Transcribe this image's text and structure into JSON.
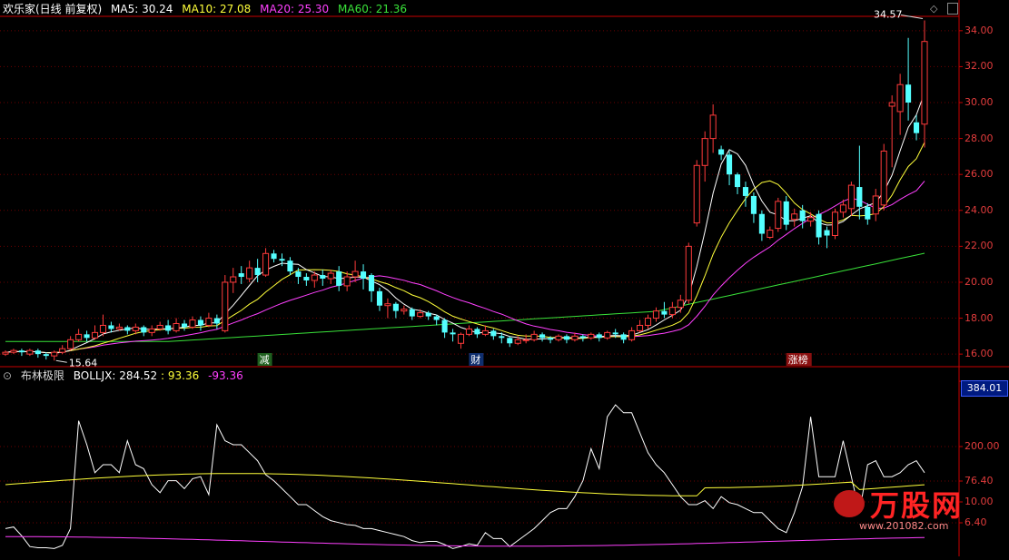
{
  "header": {
    "title": "欢乐家(日线 前复权)",
    "ma": [
      {
        "label": "MA5: 30.24",
        "color": "#ffffff"
      },
      {
        "label": "MA10: 27.08",
        "color": "#ffff3a"
      },
      {
        "label": "MA20: 25.30",
        "color": "#ff40ff"
      },
      {
        "label": "MA60: 21.36",
        "color": "#39e239"
      }
    ]
  },
  "indicator": {
    "label": "布林极限",
    "formula": "BOLLJX: 284.52",
    "upper": ": 93.36",
    "lower": "-93.36",
    "current_badge": "384.01",
    "y_ticks": [
      "384.01",
      "200.00",
      "76.40",
      "10.00",
      "6.40"
    ]
  },
  "markers": {
    "high_label": "34.57",
    "low_label": "15.64",
    "event_tags": [
      {
        "text": "减",
        "x_index": 32
      },
      {
        "text": "财",
        "x_index": 58
      },
      {
        "text": "涨榜",
        "x_index": 97
      }
    ]
  },
  "watermark": {
    "brand": "万股网",
    "site": "www.201082.com"
  },
  "colors": {
    "up": "#ff3b3b",
    "down": "#54ffff",
    "ma5": "#ffffff",
    "ma10": "#ffff3a",
    "ma20": "#ff40ff",
    "ma60": "#39e239",
    "grid": "#6b0000",
    "axis": "#c80000"
  },
  "chart_data": {
    "type": "candlestick",
    "price_axis": {
      "ylim": [
        15.3,
        34.8
      ],
      "ticks": [
        16.0,
        18.0,
        20.0,
        22.0,
        24.0,
        26.0,
        28.0,
        30.0,
        32.0,
        34.0
      ]
    },
    "candles": [
      [
        16.0,
        16.1,
        15.9,
        16.2
      ],
      [
        16.1,
        16.2,
        16.0,
        16.3
      ],
      [
        16.2,
        16.1,
        15.9,
        16.3
      ],
      [
        16.0,
        16.2,
        15.9,
        16.3
      ],
      [
        16.2,
        16.0,
        15.8,
        16.3
      ],
      [
        16.0,
        15.9,
        15.7,
        16.1
      ],
      [
        15.9,
        16.1,
        15.64,
        16.2
      ],
      [
        16.1,
        16.3,
        16.0,
        16.5
      ],
      [
        16.3,
        16.8,
        16.2,
        17.0
      ],
      [
        16.8,
        17.1,
        16.7,
        17.4
      ],
      [
        17.1,
        16.9,
        16.7,
        17.3
      ],
      [
        16.9,
        17.2,
        16.8,
        17.6
      ],
      [
        17.2,
        17.6,
        17.0,
        18.2
      ],
      [
        17.6,
        17.4,
        17.2,
        17.8
      ],
      [
        17.4,
        17.5,
        17.3,
        17.7
      ],
      [
        17.5,
        17.3,
        17.1,
        17.6
      ],
      [
        17.3,
        17.5,
        17.1,
        17.7
      ],
      [
        17.5,
        17.2,
        17.0,
        17.6
      ],
      [
        17.2,
        17.4,
        17.0,
        17.6
      ],
      [
        17.4,
        17.6,
        17.3,
        17.8
      ],
      [
        17.6,
        17.3,
        17.1,
        17.9
      ],
      [
        17.3,
        17.7,
        17.2,
        18.0
      ],
      [
        17.7,
        17.5,
        17.3,
        17.9
      ],
      [
        17.5,
        17.9,
        17.4,
        18.1
      ],
      [
        17.9,
        17.6,
        17.3,
        18.1
      ],
      [
        17.6,
        18.0,
        17.5,
        18.3
      ],
      [
        18.0,
        17.7,
        17.4,
        18.2
      ],
      [
        17.3,
        20.0,
        17.2,
        20.4
      ],
      [
        20.0,
        20.3,
        19.4,
        20.8
      ],
      [
        20.5,
        20.3,
        19.9,
        20.9
      ],
      [
        20.2,
        20.8,
        20.0,
        21.2
      ],
      [
        20.8,
        20.4,
        20.0,
        21.3
      ],
      [
        20.4,
        21.6,
        20.3,
        21.9
      ],
      [
        21.6,
        21.3,
        21.1,
        21.8
      ],
      [
        21.3,
        21.2,
        20.9,
        21.6
      ],
      [
        21.2,
        20.6,
        20.4,
        21.4
      ],
      [
        20.6,
        20.3,
        19.9,
        20.8
      ],
      [
        20.3,
        20.1,
        19.8,
        20.5
      ],
      [
        20.1,
        20.4,
        19.7,
        20.6
      ],
      [
        20.4,
        20.2,
        19.8,
        20.7
      ],
      [
        20.2,
        20.5,
        19.9,
        20.7
      ],
      [
        20.6,
        19.8,
        19.5,
        20.9
      ],
      [
        19.8,
        20.3,
        19.5,
        20.6
      ],
      [
        20.3,
        20.6,
        20.0,
        21.2
      ],
      [
        20.6,
        20.2,
        19.6,
        21.0
      ],
      [
        20.4,
        19.5,
        18.9,
        20.5
      ],
      [
        19.5,
        18.7,
        18.4,
        19.7
      ],
      [
        18.7,
        18.8,
        18.0,
        19.1
      ],
      [
        18.8,
        18.4,
        18.0,
        18.9
      ],
      [
        18.4,
        18.5,
        18.2,
        18.7
      ],
      [
        18.5,
        18.1,
        17.9,
        18.6
      ],
      [
        18.1,
        18.3,
        18.0,
        18.5
      ],
      [
        18.3,
        18.1,
        17.9,
        18.4
      ],
      [
        18.1,
        17.9,
        17.6,
        18.2
      ],
      [
        17.9,
        17.2,
        16.9,
        18.0
      ],
      [
        17.2,
        17.1,
        16.7,
        17.4
      ],
      [
        16.6,
        17.1,
        16.3,
        17.2
      ],
      [
        17.1,
        17.4,
        17.0,
        17.6
      ],
      [
        17.4,
        17.1,
        16.9,
        17.5
      ],
      [
        17.1,
        17.3,
        17.0,
        17.6
      ],
      [
        17.3,
        17.0,
        16.8,
        17.4
      ],
      [
        17.0,
        16.9,
        16.6,
        17.2
      ],
      [
        16.9,
        16.6,
        16.4,
        17.0
      ],
      [
        16.6,
        16.8,
        16.5,
        17.0
      ],
      [
        16.8,
        16.8,
        16.6,
        17.1
      ],
      [
        16.8,
        17.1,
        16.7,
        17.3
      ],
      [
        17.1,
        16.9,
        16.7,
        17.2
      ],
      [
        16.9,
        16.8,
        16.6,
        17.0
      ],
      [
        16.8,
        17.0,
        16.7,
        17.1
      ],
      [
        17.0,
        16.8,
        16.6,
        17.1
      ],
      [
        16.8,
        17.0,
        16.7,
        17.2
      ],
      [
        17.0,
        16.9,
        16.7,
        17.1
      ],
      [
        16.9,
        17.1,
        16.8,
        17.2
      ],
      [
        17.1,
        16.9,
        16.7,
        17.2
      ],
      [
        16.9,
        17.2,
        16.8,
        17.3
      ],
      [
        17.2,
        17.1,
        16.9,
        17.4
      ],
      [
        17.1,
        16.8,
        16.6,
        17.2
      ],
      [
        16.8,
        17.3,
        16.7,
        17.5
      ],
      [
        17.3,
        17.6,
        17.2,
        17.9
      ],
      [
        17.6,
        18.0,
        17.4,
        18.2
      ],
      [
        18.0,
        18.4,
        17.8,
        18.6
      ],
      [
        18.4,
        18.2,
        18.0,
        18.9
      ],
      [
        18.2,
        18.6,
        18.0,
        18.9
      ],
      [
        18.6,
        19.0,
        18.3,
        19.3
      ],
      [
        19.0,
        22.0,
        18.8,
        22.2
      ],
      [
        23.3,
        26.5,
        23.1,
        26.8
      ],
      [
        26.5,
        28.0,
        25.6,
        28.4
      ],
      [
        28.0,
        29.3,
        27.2,
        29.9
      ],
      [
        27.4,
        27.1,
        26.8,
        27.6
      ],
      [
        27.1,
        26.0,
        25.4,
        27.3
      ],
      [
        26.0,
        25.3,
        24.9,
        26.1
      ],
      [
        25.3,
        24.8,
        24.2,
        25.6
      ],
      [
        24.8,
        23.8,
        23.3,
        25.0
      ],
      [
        23.8,
        22.7,
        22.3,
        24.0
      ],
      [
        22.5,
        22.9,
        22.4,
        23.1
      ],
      [
        23.0,
        24.5,
        22.8,
        24.7
      ],
      [
        24.5,
        23.2,
        22.9,
        24.8
      ],
      [
        23.5,
        23.8,
        23.1,
        24.1
      ],
      [
        24.0,
        23.4,
        23.0,
        24.3
      ],
      [
        23.4,
        23.6,
        23.1,
        23.9
      ],
      [
        23.8,
        22.5,
        22.1,
        24.0
      ],
      [
        22.9,
        22.6,
        21.9,
        23.1
      ],
      [
        22.6,
        23.9,
        22.4,
        24.1
      ],
      [
        23.9,
        24.3,
        23.6,
        24.6
      ],
      [
        24.1,
        25.4,
        23.7,
        25.6
      ],
      [
        25.3,
        24.2,
        23.5,
        27.6
      ],
      [
        24.2,
        23.5,
        23.2,
        24.4
      ],
      [
        23.8,
        24.8,
        23.4,
        25.2
      ],
      [
        24.3,
        27.3,
        24.0,
        27.7
      ],
      [
        29.8,
        30.0,
        26.4,
        30.4
      ],
      [
        29.5,
        31.0,
        28.2,
        31.6
      ],
      [
        31.0,
        30.0,
        29.0,
        33.6
      ],
      [
        28.9,
        28.3,
        27.9,
        29.3
      ],
      [
        28.8,
        33.4,
        27.5,
        34.57
      ]
    ]
  }
}
